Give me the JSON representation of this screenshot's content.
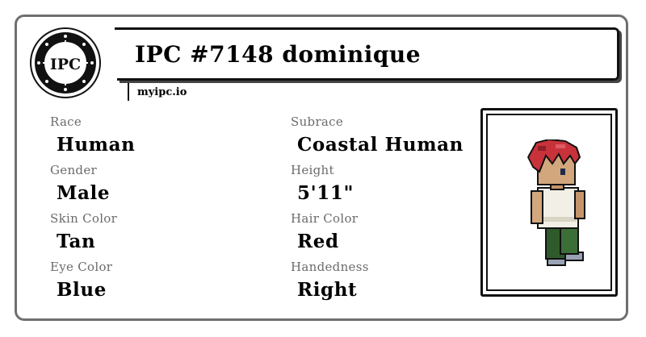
{
  "card": {
    "title": "IPC #7148 dominique",
    "site": "myipc.io",
    "logo_text": "IPC"
  },
  "fields": {
    "race": {
      "label": "Race",
      "value": "Human"
    },
    "subrace": {
      "label": "Subrace",
      "value": "Coastal Human"
    },
    "gender": {
      "label": "Gender",
      "value": "Male"
    },
    "height": {
      "label": "Height",
      "value": "5'11\""
    },
    "skin_color": {
      "label": "Skin Color",
      "value": "Tan"
    },
    "hair_color": {
      "label": "Hair Color",
      "value": "Red"
    },
    "eye_color": {
      "label": "Eye Color",
      "value": "Blue"
    },
    "handedness": {
      "label": "Handedness",
      "value": "Right"
    }
  },
  "colors": {
    "border": "#6f6f6f",
    "label_gray": "#6b6b6b",
    "hair": "#c8323a",
    "skin": "#d2a77d",
    "shirt": "#f2f0e6",
    "pants": "#2f5a2c"
  },
  "portrait": {
    "icon": "character-sprite"
  }
}
